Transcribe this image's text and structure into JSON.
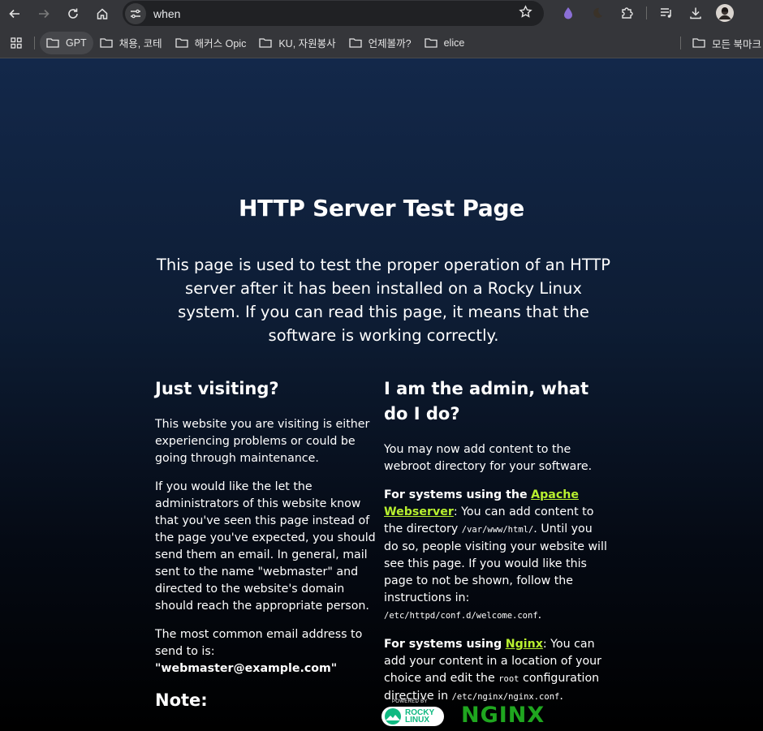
{
  "browser": {
    "url": "when",
    "bookmarks": [
      {
        "label": "GPT"
      },
      {
        "label": "채용, 코테"
      },
      {
        "label": "해커스 Opic"
      },
      {
        "label": "KU, 자원봉사"
      },
      {
        "label": "언제볼까?"
      },
      {
        "label": "elice"
      }
    ],
    "all_bookmarks_label": "모든 북마크"
  },
  "page": {
    "title": "HTTP Server Test Page",
    "lead": "This page is used to test the proper operation of an HTTP server after it has been installed on a Rocky Linux system. If you can read this page, it means that the software is working correctly.",
    "left": {
      "heading": "Just visiting?",
      "p1": "This website you are visiting is either experiencing problems or could be going through maintenance.",
      "p2": "If you would like the let the administrators of this website know that you've seen this page instead of the page you've expected, you should send them an email. In general, mail sent to the name \"webmaster\" and directed to the website's domain should reach the appropriate person.",
      "p3": "The most common email address to send to is:",
      "email": "\"webmaster@example.com\"",
      "note": "Note:"
    },
    "right": {
      "heading": "I am the admin, what do I do?",
      "p1": "You may now add content to the webroot directory for your software.",
      "apache_prefix": "For systems using the",
      "apache_link": "Apache Webserver",
      "apache_text1": ": You can add content to the directory",
      "apache_dir": "/var/www/html/",
      "apache_text2": ". Until you do so, people visiting your website will see this page. If you would like this page to not be shown, follow the instructions in:",
      "apache_conf": "/etc/httpd/conf.d/welcome.conf",
      "apache_end": ".",
      "nginx_prefix": "For systems using",
      "nginx_link": "Nginx",
      "nginx_text1": ": You can add your content in a location of your choice and edit the",
      "nginx_root": "root",
      "nginx_text2": "configuration directive in",
      "nginx_conf": "/etc/nginx/nginx.conf",
      "nginx_end": "."
    },
    "logos": {
      "rocky_powered": "POWERED BY",
      "rocky_line1": "ROCKY",
      "rocky_line2": "LINUX",
      "nginx": "NGINX"
    }
  },
  "colors": {
    "link": "#b8f02f",
    "nginx_green": "#1fa61f",
    "rocky_green": "#10b981",
    "chrome_bg": "#35363a"
  },
  "icons": [
    "back-icon",
    "forward-icon",
    "reload-icon",
    "home-icon",
    "tune-icon",
    "star-icon",
    "drop-extension-icon",
    "moon-extension-icon",
    "puzzle-icon",
    "media-icon",
    "download-icon",
    "profile-avatar",
    "apps-grid-icon",
    "folder-icon"
  ]
}
